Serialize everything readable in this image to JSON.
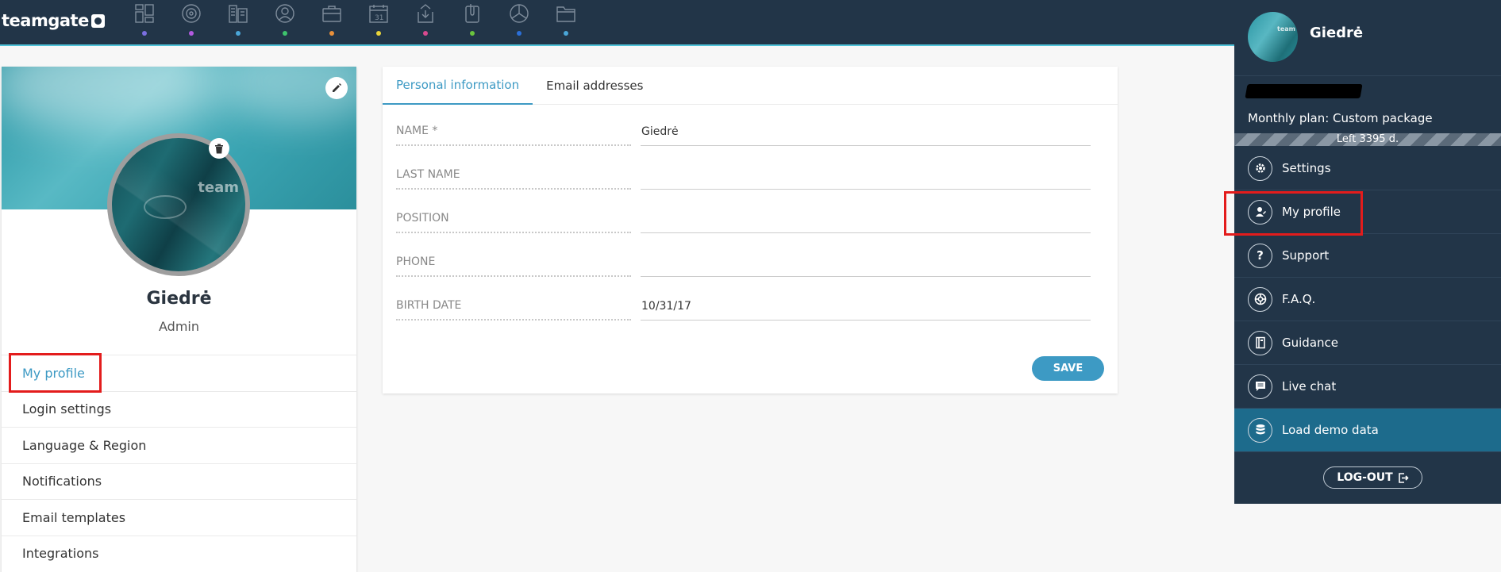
{
  "app": {
    "logo_text": "teamgate"
  },
  "nav": {
    "icons": [
      {
        "name": "dashboard-icon",
        "dot": "#7b6fe0"
      },
      {
        "name": "target-icon",
        "dot": "#b25ae0"
      },
      {
        "name": "companies-icon",
        "dot": "#4aa6d8"
      },
      {
        "name": "contacts-icon",
        "dot": "#3ec46d"
      },
      {
        "name": "deals-icon",
        "dot": "#e8903a"
      },
      {
        "name": "calendar-icon",
        "dot": "#e8d43a"
      },
      {
        "name": "inbox-icon",
        "dot": "#d84a8f"
      },
      {
        "name": "documents-icon",
        "dot": "#6ac43e"
      },
      {
        "name": "reports-icon",
        "dot": "#2b6fd8"
      },
      {
        "name": "folder-icon",
        "dot": "#4aa6d8"
      }
    ]
  },
  "profile": {
    "name": "Giedrė",
    "role": "Admin",
    "avatar_watermark": "team",
    "menu": [
      "My profile",
      "Login settings",
      "Language & Region",
      "Notifications",
      "Email templates",
      "Integrations"
    ]
  },
  "form": {
    "tabs": [
      "Personal information",
      "Email addresses"
    ],
    "fields": [
      {
        "label": "NAME *",
        "value": "Giedrė"
      },
      {
        "label": "LAST NAME",
        "value": ""
      },
      {
        "label": "POSITION",
        "value": ""
      },
      {
        "label": "PHONE",
        "value": ""
      },
      {
        "label": "BIRTH DATE",
        "value": "10/31/17"
      }
    ],
    "save_label": "SAVE"
  },
  "dropdown": {
    "name": "Giedrė",
    "avatar_watermark": "team",
    "plan": "Monthly plan: Custom package",
    "left": "Left 3395 d.",
    "items": [
      {
        "label": "Settings",
        "icon": "gear-icon"
      },
      {
        "label": "My profile",
        "icon": "user-edit-icon"
      },
      {
        "label": "Support",
        "icon": "question-icon"
      },
      {
        "label": "F.A.Q.",
        "icon": "lifebuoy-icon"
      },
      {
        "label": "Guidance",
        "icon": "book-icon"
      },
      {
        "label": "Live chat",
        "icon": "chat-icon"
      },
      {
        "label": "Load demo data",
        "icon": "database-icon"
      }
    ],
    "logout_label": "LOG-OUT"
  },
  "colors": {
    "topbar": "#223548",
    "accent": "#3d9ac4",
    "highlight": "#1d6b8c",
    "annotation": "#e31c1c"
  }
}
